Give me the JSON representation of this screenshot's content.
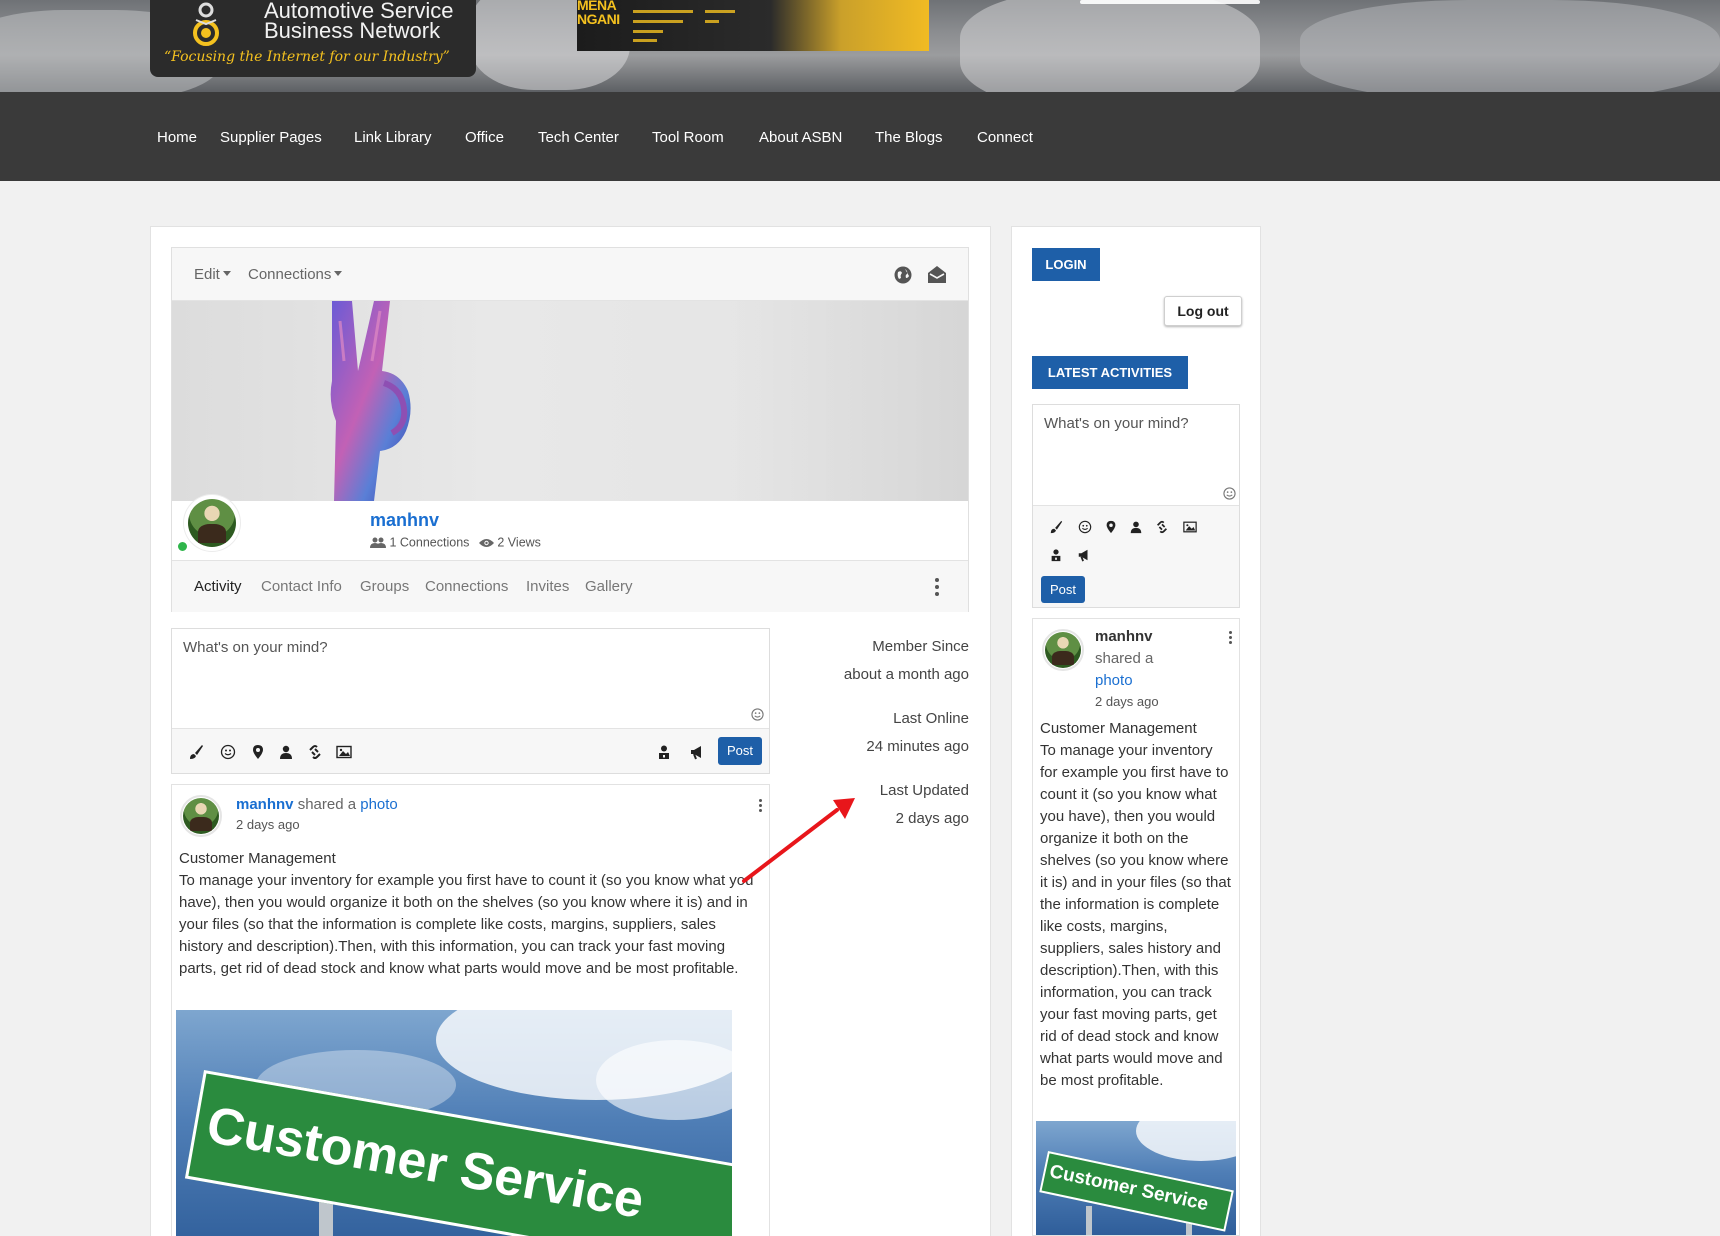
{
  "site": {
    "title_line1": "Automotive Service",
    "title_line2": "Business Network",
    "tagline": "“Focusing the Internet for our Industry”",
    "ad_text": "MENA NGANI"
  },
  "nav": {
    "items": [
      "Home",
      "Supplier Pages",
      "Link Library",
      "Office",
      "Tech Center",
      "Tool Room",
      "About ASBN",
      "The Blogs",
      "Connect"
    ]
  },
  "profile": {
    "menu_edit": "Edit",
    "menu_connections": "Connections",
    "username": "manhnv",
    "connections_text": "1 Connections",
    "views_text": "2 Views",
    "tabs": [
      "Activity",
      "Contact Info",
      "Groups",
      "Connections",
      "Invites",
      "Gallery"
    ],
    "active_tab": "Activity"
  },
  "composer": {
    "placeholder": "What's on your mind?",
    "post_label": "Post"
  },
  "meta": {
    "member_since_label": "Member Since",
    "member_since_value": "about a month ago",
    "last_online_label": "Last Online",
    "last_online_value": "24 minutes ago",
    "last_updated_label": "Last Updated",
    "last_updated_value": "2 days ago"
  },
  "post": {
    "author": "manhnv",
    "action": "shared a",
    "object": "photo",
    "time": "2 days ago",
    "title": "Customer Management",
    "body": "To manage your inventory for example you first have to count it (so you know what you have), then you would organize it both on the shelves (so you know where it is) and in your files (so that the information is complete like costs, margins, suppliers, sales history and description).Then, with this information, you can track your fast moving parts, get rid of dead stock and know what parts would move and be most profitable.",
    "image_sign_text": "Customer Service"
  },
  "sidebar": {
    "login_label": "LOGIN",
    "logout_label": "Log out",
    "latest_label": "LATEST ACTIVITIES",
    "composer_placeholder": "What's on your mind?",
    "post_label": "Post"
  },
  "colors": {
    "accent": "#1e5fa8",
    "link": "#1a6fd1",
    "navbar": "#3a3a3a",
    "online": "#2fb54b",
    "annotation": "#e8161b"
  },
  "icons": [
    "globe-icon",
    "envelope-icon",
    "users-icon",
    "eye-icon",
    "brush-icon",
    "smile-icon",
    "map-pin-icon",
    "user-icon",
    "link-icon",
    "image-icon",
    "lock-icon",
    "megaphone-icon",
    "kebab-icon",
    "arrow-annotation"
  ]
}
